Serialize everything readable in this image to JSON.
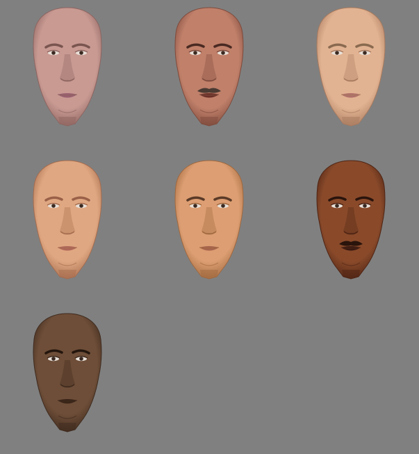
{
  "background_color": "#808080",
  "faces": [
    {
      "id": "face-1",
      "skin": "#c89a92",
      "shade": "#8e6460",
      "lip": "#9a6070",
      "brow": "#7a5550",
      "mustache": false
    },
    {
      "id": "face-2",
      "skin": "#c0806a",
      "shade": "#7e4a3c",
      "lip": "#6a3028",
      "brow": "#4a2a22",
      "mustache": true,
      "mustache_color": "#4a3a32"
    },
    {
      "id": "face-3",
      "skin": "#e2b392",
      "shade": "#a87a5e",
      "lip": "#b0706a",
      "brow": "#8a6a50",
      "mustache": false
    },
    {
      "id": "face-4",
      "skin": "#e0a882",
      "shade": "#a66c4e",
      "lip": "#b0685a",
      "brow": "#9a6048",
      "mustache": false
    },
    {
      "id": "face-5",
      "skin": "#dc9e72",
      "shade": "#a0683e",
      "lip": "#a8644e",
      "brow": "#5a3a28",
      "mustache": false
    },
    {
      "id": "face-6",
      "skin": "#8a4a2a",
      "shade": "#4e2414",
      "lip": "#3a1a12",
      "brow": "#2a140c",
      "mustache": true,
      "mustache_color": "#2a140c"
    },
    {
      "id": "face-7",
      "skin": "#6e4e38",
      "shade": "#3e2a1e",
      "lip": "#3a2418",
      "brow": "#24160e",
      "mustache": false
    }
  ]
}
